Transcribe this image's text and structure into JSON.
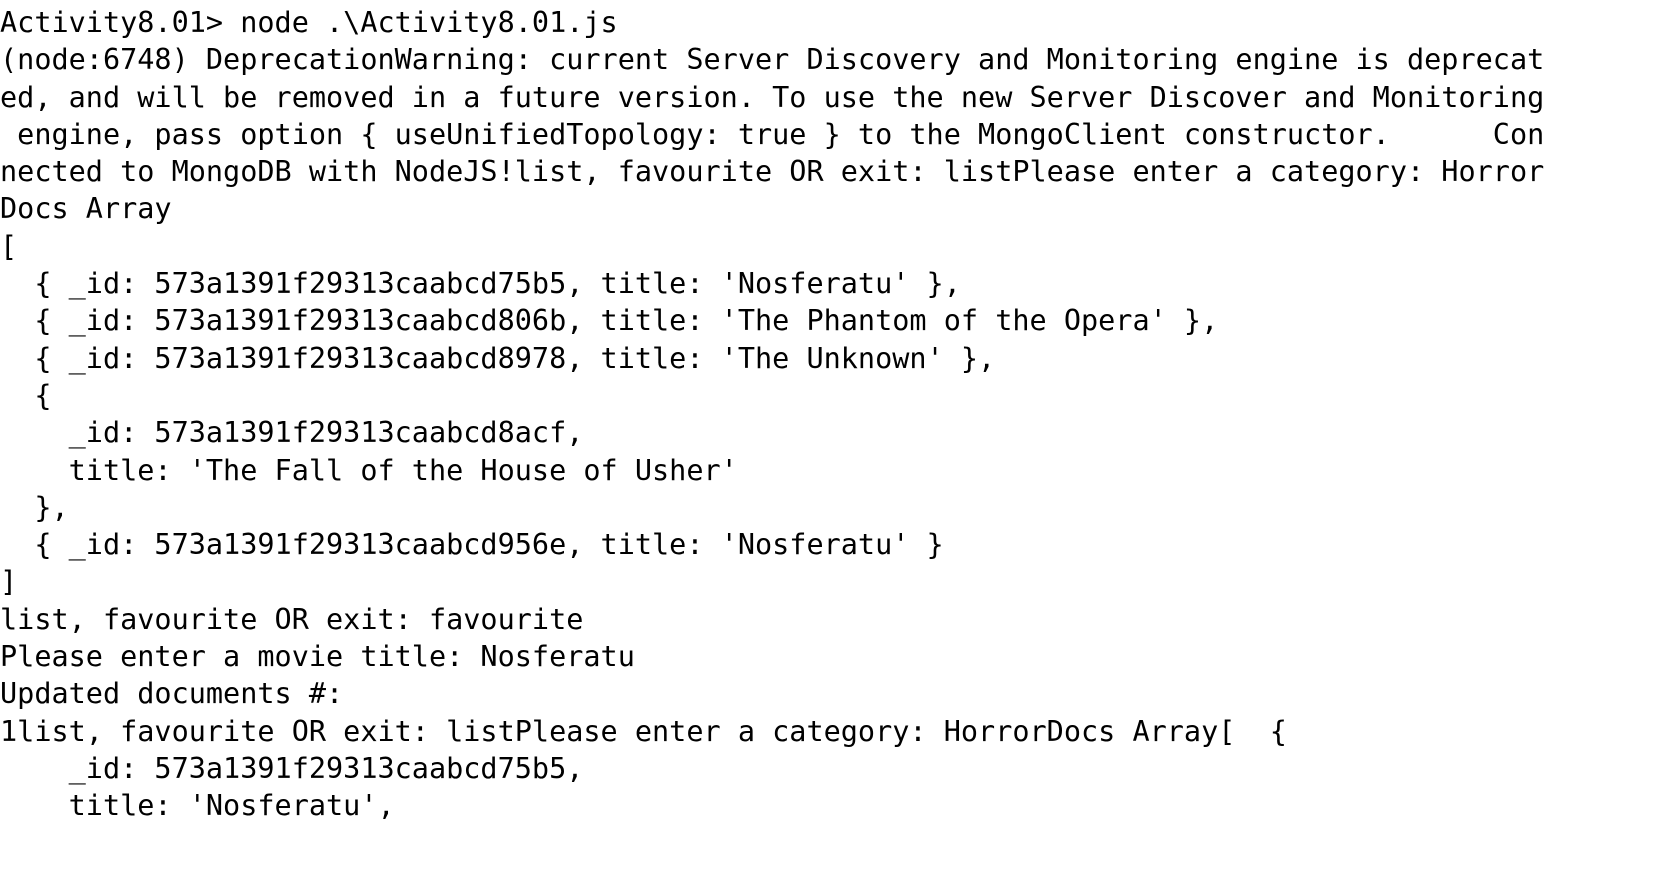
{
  "terminal": {
    "lines": [
      "Activity8.01> node .\\Activity8.01.js",
      "(node:6748) DeprecationWarning: current Server Discovery and Monitoring engine is deprecat",
      "ed, and will be removed in a future version. To use the new Server Discover and Monitoring",
      " engine, pass option { useUnifiedTopology: true } to the MongoClient constructor.      Con",
      "nected to MongoDB with NodeJS!list, favourite OR exit: listPlease enter a category: Horror",
      "Docs Array",
      "[",
      "  { _id: 573a1391f29313caabcd75b5, title: 'Nosferatu' },",
      "  { _id: 573a1391f29313caabcd806b, title: 'The Phantom of the Opera' },",
      "  { _id: 573a1391f29313caabcd8978, title: 'The Unknown' },",
      "  {",
      "    _id: 573a1391f29313caabcd8acf,",
      "    title: 'The Fall of the House of Usher'",
      "  },",
      "  { _id: 573a1391f29313caabcd956e, title: 'Nosferatu' }",
      "]",
      "list, favourite OR exit: favourite",
      "Please enter a movie title: Nosferatu",
      "Updated documents #:",
      "1list, favourite OR exit: listPlease enter a category: HorrorDocs Array[  {",
      "    _id: 573a1391f29313caabcd75b5,",
      "    title: 'Nosferatu',"
    ]
  },
  "colors": {
    "background": "#ffffff",
    "text": "#000000"
  }
}
